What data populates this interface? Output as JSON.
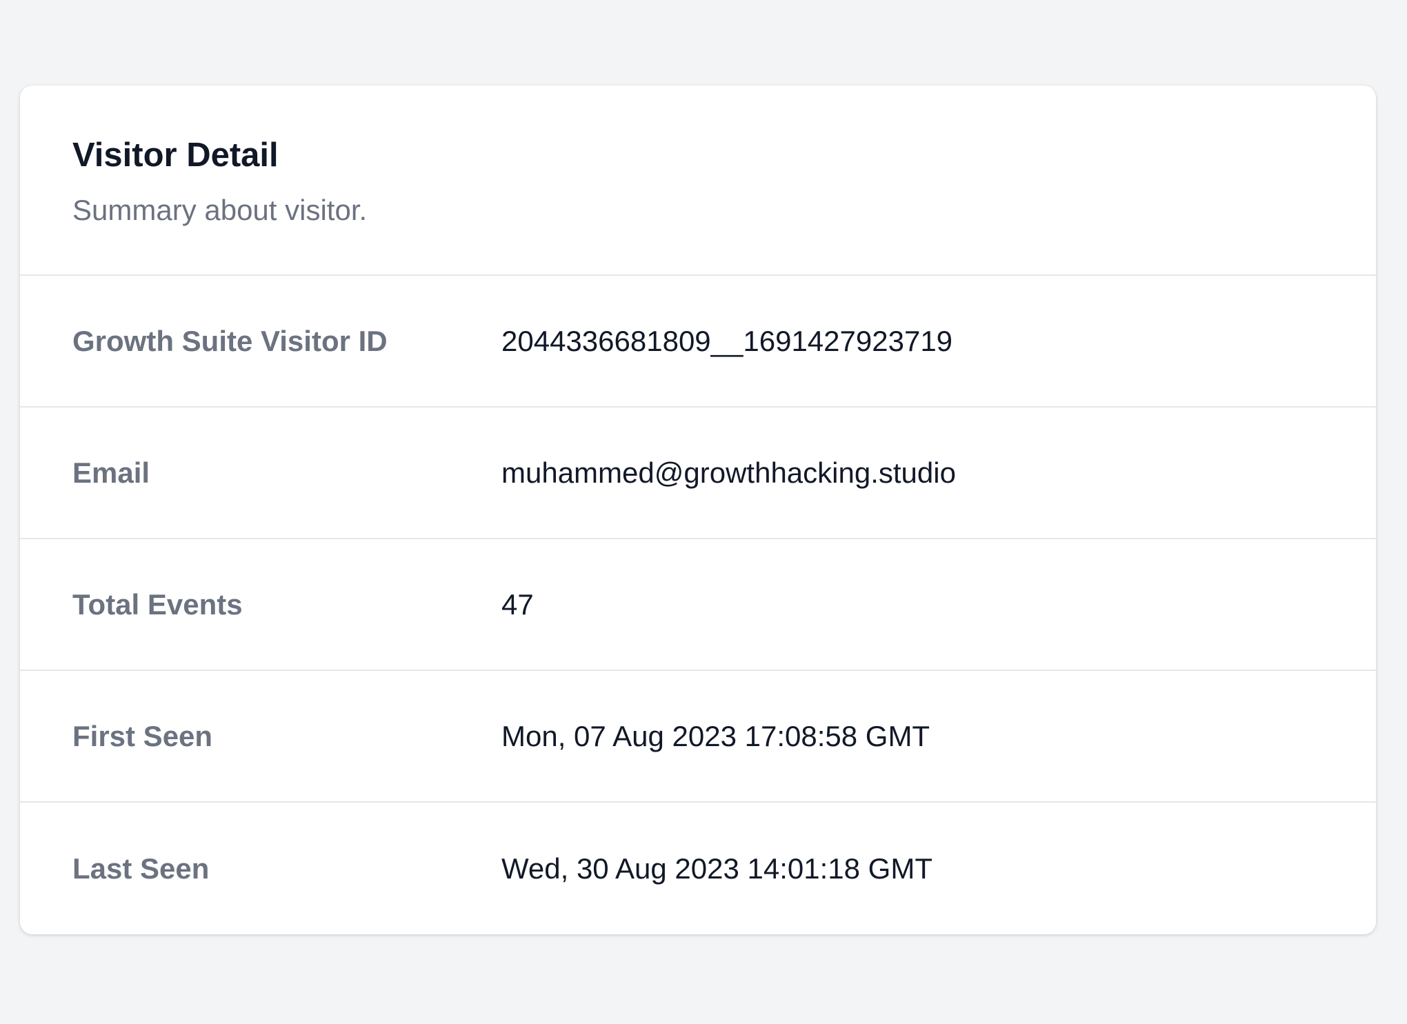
{
  "card": {
    "title": "Visitor Detail",
    "subtitle": "Summary about visitor."
  },
  "details": [
    {
      "label": "Growth Suite Visitor ID",
      "value": "2044336681809__1691427923719"
    },
    {
      "label": "Email",
      "value": "muhammed@growthhacking.studio"
    },
    {
      "label": "Total Events",
      "value": "47"
    },
    {
      "label": "First Seen",
      "value": "Mon, 07 Aug 2023 17:08:58 GMT"
    },
    {
      "label": "Last Seen",
      "value": "Wed, 30 Aug 2023 14:01:18 GMT"
    }
  ],
  "colors": {
    "page_background": "#f3f4f6",
    "card_background": "#ffffff",
    "title_text": "#111827",
    "muted_text": "#6b7280",
    "divider": "#e5e7eb"
  }
}
